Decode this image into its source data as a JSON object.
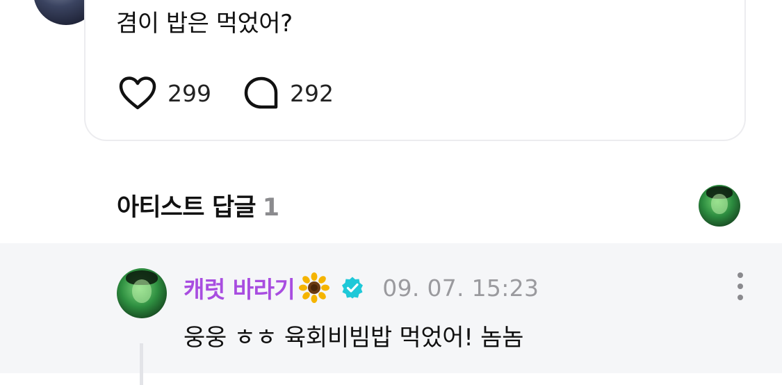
{
  "post": {
    "text": "겸이 밥은 먹었어?",
    "likes": "299",
    "comments": "292"
  },
  "artist_replies": {
    "title": "아티스트 답글",
    "count": "1"
  },
  "reply": {
    "author": "캐럿 바라기",
    "author_emoji": "sunflower",
    "timestamp": "09. 07. 15:23",
    "text": "웅웅 ㅎㅎ 육회비빔밥 먹었어! 놈놈"
  },
  "colors": {
    "author_name": "#a84de0",
    "verified_badge": "#1ec8d8",
    "reply_background": "#f5f6f8",
    "muted_text": "#9a9a9e"
  },
  "icons": [
    "heart-icon",
    "comment-bubble-icon",
    "sunflower-icon",
    "verified-badge-icon",
    "more-vertical-icon"
  ]
}
